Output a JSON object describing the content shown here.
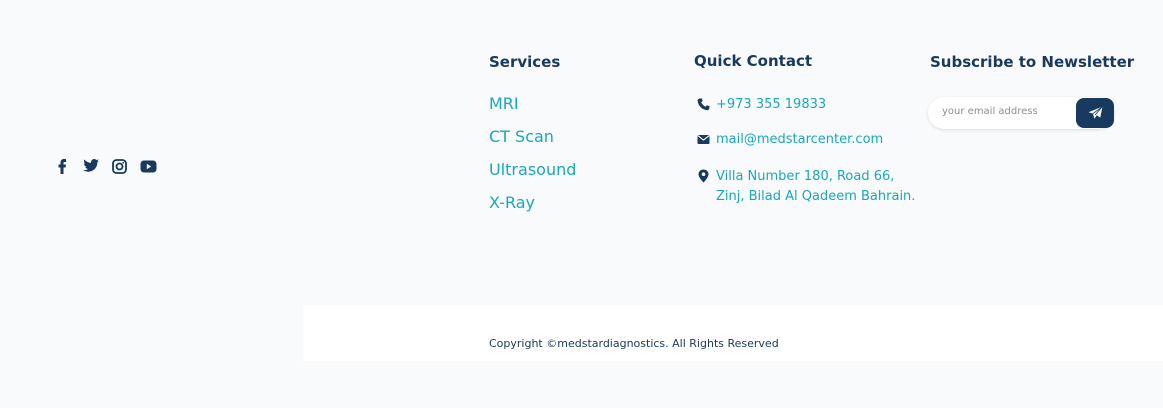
{
  "social": {
    "icons": [
      "facebook-icon",
      "twitter-icon",
      "instagram-icon",
      "youtube-icon"
    ]
  },
  "services": {
    "title": "Services",
    "items": [
      "MRI",
      "CT Scan",
      "Ultrasound",
      "X-Ray"
    ]
  },
  "contact": {
    "title": "Quick Contact",
    "phone": "+973 355 19833",
    "email": "mail@medstarcenter.com",
    "address": "Villa Number 180, Road 66, Zinj, Bilad Al Qadeem Bahrain."
  },
  "newsletter": {
    "title": "Subscribe to Newsletter",
    "placeholder": "your email address"
  },
  "footer": {
    "copyright": "Copyright ©medstardiagnostics. All Rights Reserved"
  },
  "colors": {
    "navy": "#173a5e",
    "teal": "#1aa8b8",
    "background": "#f9fafb"
  }
}
